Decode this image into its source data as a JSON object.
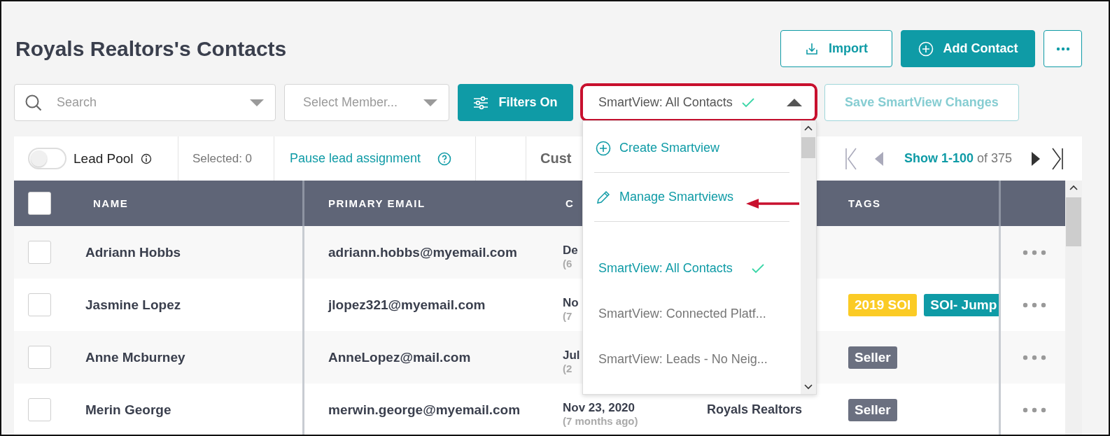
{
  "page_title": "Royals Realtors's Contacts",
  "header_buttons": [
    {
      "kind": "import",
      "label": "Import"
    },
    {
      "kind": "add",
      "label": "Add Contact"
    },
    {
      "kind": "more"
    }
  ],
  "filters": {
    "search": {
      "placeholder": "Search"
    },
    "member": {
      "placeholder": "Select Member..."
    },
    "filters_button": {
      "label": "Filters On"
    },
    "smartview": {
      "value": "SmartView: All Contacts",
      "expanded": true,
      "highlighted": true
    },
    "save_button": {
      "label": "Save SmartView Changes",
      "disabled": true
    }
  },
  "toolbar": {
    "lead_pool": {
      "label": "Lead Pool",
      "on": false
    },
    "selected": "Selected: 0",
    "pause_link": "Pause lead assignment",
    "column_4": "Cust",
    "pagination": {
      "range": "Show 1-100",
      "total": "of 375"
    }
  },
  "table": {
    "select_all": {
      "checked": false
    },
    "headers": {
      "name": "NAME",
      "email": "PRIMARY EMAIL",
      "column_3": "C",
      "tags": "TAGS"
    },
    "rows": [
      {
        "checked": false,
        "name": "Adriann Hobbs",
        "email": "adriann.hobbs@myemail.com",
        "date": "De",
        "date_ago": "(6"
      },
      {
        "checked": false,
        "name": "Jasmine Lopez",
        "email": "jlopez321@myemail.com",
        "date": "No",
        "date_ago": "(7",
        "tags": [
          {
            "label": "2019 SOI",
            "color": "#fbcb25"
          },
          {
            "label": "SOI- Jump",
            "color": "#0f9ba6"
          }
        ]
      },
      {
        "checked": false,
        "name": "Anne Mcburney",
        "email": "AnneLopez@mail.com",
        "date": "Jul",
        "date_ago": "(2",
        "tags": [
          {
            "label": "Seller",
            "color": "#6b7080"
          }
        ]
      },
      {
        "checked": false,
        "name": "Merin George",
        "email": "merwin.george@myemail.com",
        "date": "Nov 23, 2020",
        "date_ago": "(7 months ago)",
        "column_4": "Royals Realtors",
        "tags": [
          {
            "label": "Seller",
            "color": "#6b7080"
          }
        ]
      }
    ]
  },
  "smartview_menu": {
    "actions": [
      {
        "kind": "create",
        "label": "Create Smartview",
        "pointed": false
      },
      {
        "kind": "manage",
        "label": "Manage Smartviews",
        "pointed": true
      }
    ],
    "options": [
      {
        "label": "SmartView: All Contacts",
        "selected": true
      },
      {
        "label": "SmartView: Connected Platf...",
        "selected": false
      },
      {
        "label": "SmartView: Leads - No Neig...",
        "selected": false
      }
    ]
  }
}
